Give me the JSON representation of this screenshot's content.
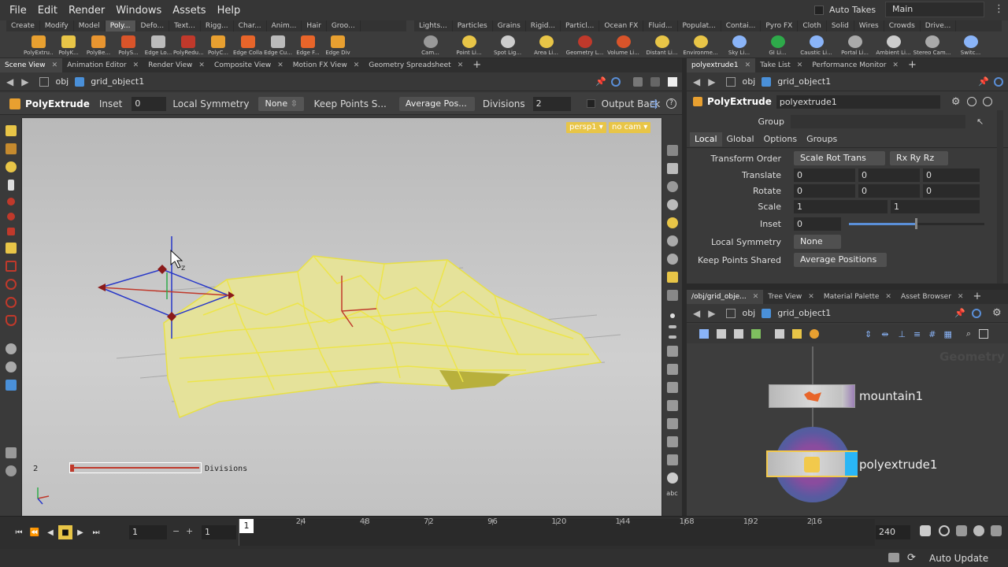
{
  "menubar": {
    "items": [
      "File",
      "Edit",
      "Render",
      "Windows",
      "Assets",
      "Help"
    ],
    "auto_takes_label": "Auto Takes",
    "desktop_label": "Main"
  },
  "shelf_left": {
    "tabs": [
      "Create",
      "Modify",
      "Model",
      "Poly...",
      "Defo...",
      "Text...",
      "Rigg...",
      "Char...",
      "Anim...",
      "Hair",
      "Groo..."
    ],
    "active_tab": "Poly...",
    "tools": [
      "PolyExtru...",
      "PolyK...",
      "PolyBe...",
      "PolyS...",
      "Edge Lo...",
      "PolyRedu...",
      "PolyC...",
      "Edge Colla...",
      "Edge Cu...",
      "Edge F...",
      "Edge Div"
    ]
  },
  "shelf_right": {
    "tabs": [
      "Lights...",
      "Particles",
      "Grains",
      "Rigid...",
      "Particl...",
      "Ocean FX",
      "Fluid...",
      "Populat...",
      "Contai...",
      "Pyro FX",
      "Cloth",
      "Solid",
      "Wires",
      "Crowds",
      "Drive..."
    ],
    "tools": [
      "Cam...",
      "Point Li...",
      "Spot Lig...",
      "Area Li...",
      "Geometry L...",
      "Volume Li...",
      "Distant Li...",
      "Environme...",
      "Sky Li...",
      "GI Li...",
      "Caustic Li...",
      "Portal Li...",
      "Ambient Li...",
      "Stereo Cam...",
      "Switc..."
    ]
  },
  "left_pane": {
    "tabs": [
      "Scene View",
      "Animation Editor",
      "Render View",
      "Composite View",
      "Motion FX View",
      "Geometry Spreadsheet"
    ],
    "path": [
      "obj",
      "grid_object1"
    ],
    "op_toolbar": {
      "node_type": "PolyExtrude",
      "inset_label": "Inset",
      "inset_value": "0",
      "local_symmetry_label": "Local Symmetry",
      "local_symmetry_value": "None",
      "keep_points_label": "Keep Points S...",
      "keep_points_value": "Average Pos...",
      "divisions_label": "Divisions",
      "divisions_value": "2",
      "output_back_label": "Output Back"
    },
    "viewport": {
      "camera_label": "persp1",
      "cam_menu": "no cam",
      "handle_value": "2",
      "handle_label": "Divisions",
      "axis_label_z": "z"
    }
  },
  "timeline": {
    "current_frame": "1",
    "start_frame": "1",
    "end_frame": "240",
    "playhead": "1",
    "ticks": [
      "24",
      "48",
      "72",
      "96",
      "120",
      "144",
      "168",
      "192",
      "216"
    ],
    "auto_update_label": "Auto Update"
  },
  "params_pane": {
    "tabs": [
      "polyextrude1",
      "Take List",
      "Performance Monitor"
    ],
    "path": [
      "obj",
      "grid_object1"
    ],
    "node_type": "PolyExtrude",
    "node_name": "polyextrude1",
    "group_label": "Group",
    "subtabs": [
      "Local",
      "Global",
      "Options",
      "Groups"
    ],
    "active_subtab": "Local",
    "transform_order_label": "Transform Order",
    "transform_order_value": "Scale Rot Trans",
    "rotate_order_value": "Rx Ry Rz",
    "translate_label": "Translate",
    "translate": [
      "0",
      "0",
      "0"
    ],
    "rotate_label": "Rotate",
    "rotate": [
      "0",
      "0",
      "0"
    ],
    "scale_label": "Scale",
    "scale": [
      "1",
      "1"
    ],
    "inset_label": "Inset",
    "inset_value": "0",
    "local_symmetry_label": "Local Symmetry",
    "local_symmetry_value": "None",
    "keep_points_label": "Keep Points Shared",
    "keep_points_value": "Average Positions"
  },
  "network_pane": {
    "tabs": [
      "/obj/grid_obje...",
      "Tree View",
      "Material Palette",
      "Asset Browser"
    ],
    "path": [
      "obj",
      "grid_object1"
    ],
    "watermark": "Geometry",
    "nodes": [
      {
        "name": "mountain1"
      },
      {
        "name": "polyextrude1"
      }
    ]
  },
  "colors": {
    "accent_yellow": "#e8c547",
    "selected_node": "#f2c94c",
    "display_flag": "#29b6f6"
  }
}
